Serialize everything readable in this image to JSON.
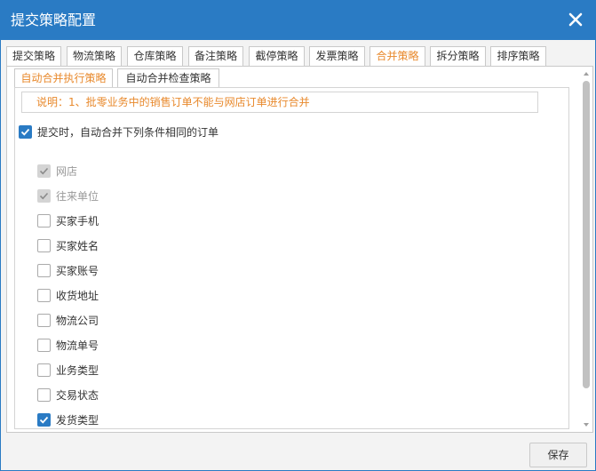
{
  "dialog": {
    "title": "提交策略配置"
  },
  "tabs": [
    {
      "label": "提交策略",
      "active": false
    },
    {
      "label": "物流策略",
      "active": false
    },
    {
      "label": "仓库策略",
      "active": false
    },
    {
      "label": "备注策略",
      "active": false
    },
    {
      "label": "截停策略",
      "active": false
    },
    {
      "label": "发票策略",
      "active": false
    },
    {
      "label": "合并策略",
      "active": true
    },
    {
      "label": "拆分策略",
      "active": false
    },
    {
      "label": "排序策略",
      "active": false
    }
  ],
  "subtabs": [
    {
      "label": "自动合并执行策略",
      "active": true
    },
    {
      "label": "自动合并检查策略",
      "active": false
    }
  ],
  "note": "说明：1、批零业务中的销售订单不能与网店订单进行合并",
  "main_option": {
    "label": "提交时，自动合并下列条件相同的订单",
    "checked": true
  },
  "conditions": [
    {
      "label": "网店",
      "checked": true,
      "disabled": true
    },
    {
      "label": "往来单位",
      "checked": true,
      "disabled": true
    },
    {
      "label": "买家手机",
      "checked": false,
      "disabled": false
    },
    {
      "label": "买家姓名",
      "checked": false,
      "disabled": false
    },
    {
      "label": "买家账号",
      "checked": false,
      "disabled": false
    },
    {
      "label": "收货地址",
      "checked": false,
      "disabled": false
    },
    {
      "label": "物流公司",
      "checked": false,
      "disabled": false
    },
    {
      "label": "物流单号",
      "checked": false,
      "disabled": false
    },
    {
      "label": "业务类型",
      "checked": false,
      "disabled": false
    },
    {
      "label": "交易状态",
      "checked": false,
      "disabled": false
    },
    {
      "label": "发货类型",
      "checked": true,
      "disabled": false
    }
  ],
  "footer": {
    "save_label": "保存"
  },
  "colors": {
    "titlebar": "#2a7bc4",
    "accent": "#e8892c",
    "checkbox": "#2a7bc4"
  }
}
